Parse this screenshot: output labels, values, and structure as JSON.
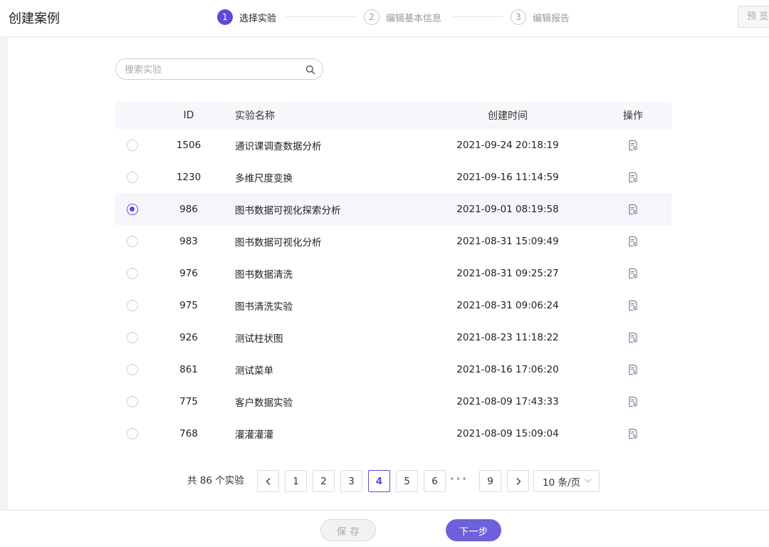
{
  "header": {
    "title": "创建案例",
    "steps": [
      {
        "number": "1",
        "label": "选择实验",
        "state": "active"
      },
      {
        "number": "2",
        "label": "编辑基本信息",
        "state": "inactive"
      },
      {
        "number": "3",
        "label": "编辑报告",
        "state": "inactive"
      }
    ],
    "preview_label": "预览"
  },
  "search": {
    "placeholder": "搜索实验",
    "value": ""
  },
  "table": {
    "columns": {
      "id": "ID",
      "name": "实验名称",
      "time": "创建时间",
      "op": "操作"
    },
    "rows": [
      {
        "id": "1506",
        "name": "通识课调查数据分析",
        "time": "2021-09-24 20:18:19",
        "selected": false
      },
      {
        "id": "1230",
        "name": "多维尺度变换",
        "time": "2021-09-16 11:14:59",
        "selected": false
      },
      {
        "id": "986",
        "name": "图书数据可视化探索分析",
        "time": "2021-09-01 08:19:58",
        "selected": true
      },
      {
        "id": "983",
        "name": "图书数据可视化分析",
        "time": "2021-08-31 15:09:49",
        "selected": false
      },
      {
        "id": "976",
        "name": "图书数据清洗",
        "time": "2021-08-31 09:25:27",
        "selected": false
      },
      {
        "id": "975",
        "name": "图书清洗实验",
        "time": "2021-08-31 09:06:24",
        "selected": false
      },
      {
        "id": "926",
        "name": "测试柱状图",
        "time": "2021-08-23 11:18:22",
        "selected": false
      },
      {
        "id": "861",
        "name": "测试菜单",
        "time": "2021-08-16 17:06:20",
        "selected": false
      },
      {
        "id": "775",
        "name": "客户数据实验",
        "time": "2021-08-09 17:43:33",
        "selected": false
      },
      {
        "id": "768",
        "name": "灌灌灌灌",
        "time": "2021-08-09 15:09:04",
        "selected": false
      }
    ]
  },
  "pagination": {
    "total_text": "共 86 个实验",
    "prev": "<",
    "next": ">",
    "pages": [
      "1",
      "2",
      "3",
      "4",
      "5",
      "6"
    ],
    "ellipsis": "•••",
    "last_page": "9",
    "current": "4",
    "page_size": "10 条/页"
  },
  "footer": {
    "save_label": "保存",
    "next_label": "下一步"
  },
  "colors": {
    "accent": "#5b4bdb",
    "next_button": "#6e5fdb",
    "selected_row": "#f5f5fb"
  }
}
